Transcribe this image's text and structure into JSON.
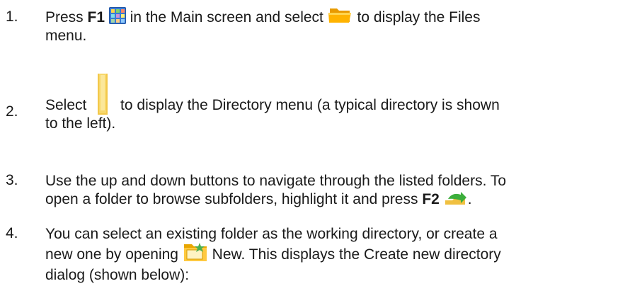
{
  "steps": [
    {
      "number": "1.",
      "parts": {
        "a": "Press ",
        "key": "F1",
        "b": " in the Main screen and select ",
        "c": " to display the Files",
        "d": "menu."
      }
    },
    {
      "number": "2.",
      "parts": {
        "a": "Select ",
        "b": " to display the Directory menu (a typical directory is shown",
        "c": "to the left)."
      }
    },
    {
      "number": "3.",
      "parts": {
        "a": "Use the up and down buttons to navigate through the listed folders. To",
        "b": "open a folder to browse subfolders, highlight it and press ",
        "key": "F2",
        "c": "."
      }
    },
    {
      "number": "4.",
      "parts": {
        "a": "You can select an existing folder as the working directory, or create a",
        "b": "new one by opening ",
        "c": " New. This displays the Create new directory",
        "d": "dialog (shown below):"
      }
    }
  ],
  "icons": {
    "main_menu": "grid-app-icon",
    "files": "open-folder-icon",
    "directory": "folder-icon",
    "open": "green-arrow-icon",
    "new": "new-folder-icon"
  },
  "colors": {
    "text": "#1a1a1a",
    "folder": "#f5b400",
    "grid": "#3a7bd5",
    "arrow": "#3cae3c"
  }
}
